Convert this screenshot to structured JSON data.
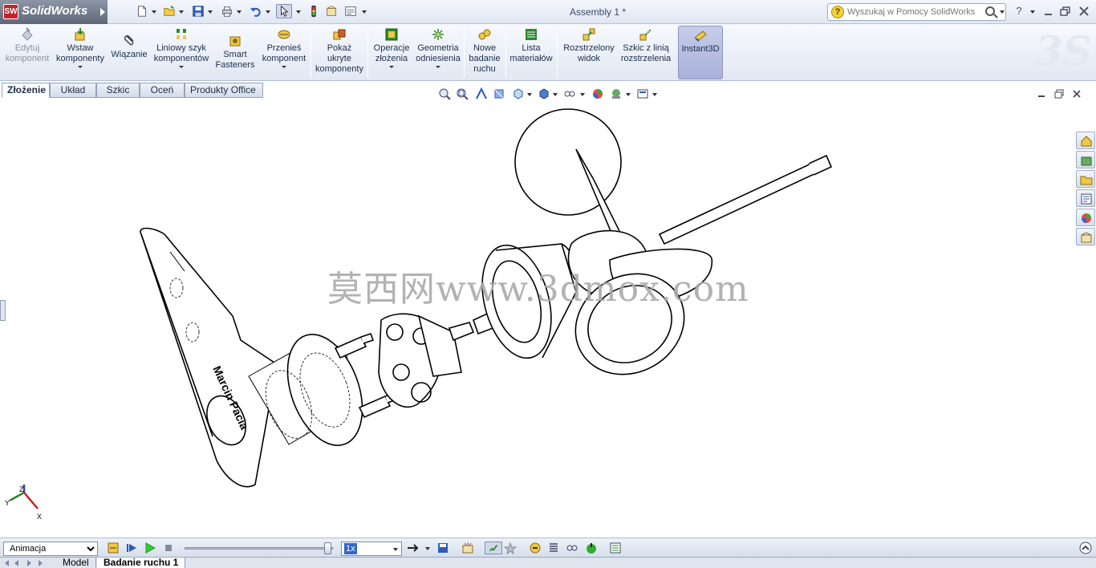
{
  "app": {
    "brand": "SolidWorks",
    "brand_mark": "SW"
  },
  "document": {
    "title": "Assembly 1 *"
  },
  "help": {
    "placeholder": "Wyszukaj w Pomocy SolidWorks",
    "help_glyph": "?"
  },
  "command_manager": {
    "commands": [
      {
        "id": "edit-component",
        "label": "Edytuj\nkomponent",
        "icon": "edit-component-icon",
        "enabled": false
      },
      {
        "id": "insert-components",
        "label": "Wstaw\nkomponenty",
        "icon": "insert-components-icon",
        "dropdown": true
      },
      {
        "id": "mate",
        "label": "Wiązanie",
        "icon": "mate-icon"
      },
      {
        "id": "linear-pattern",
        "label": "Liniowy szyk\nkomponentów",
        "icon": "linear-pattern-icon",
        "dropdown": true
      },
      {
        "id": "smart-fasteners",
        "label": "Smart\nFasteners",
        "icon": "smart-fasteners-icon"
      },
      {
        "id": "move-component",
        "label": "Przenieś\nkomponent",
        "icon": "move-component-icon",
        "dropdown": true
      },
      {
        "id": "show-hidden",
        "label": "Pokaż\nukryte\nkomponenty",
        "icon": "show-hidden-icon"
      },
      {
        "id": "assembly-features",
        "label": "Operacje\nzłożenia",
        "icon": "assembly-features-icon",
        "dropdown": true
      },
      {
        "id": "reference-geometry",
        "label": "Geometria\nodniesienia",
        "icon": "reference-geometry-icon",
        "dropdown": true
      },
      {
        "id": "new-motion-study",
        "label": "Nowe\nbadanie\nruchu",
        "icon": "motion-study-icon"
      },
      {
        "id": "bill-of-materials",
        "label": "Lista\nmateriałów",
        "icon": "bom-icon"
      },
      {
        "id": "exploded-view",
        "label": "Rozstrzelony\nwidok",
        "icon": "exploded-view-icon"
      },
      {
        "id": "explode-line-sketch",
        "label": "Szkic z linią\nrozstrzelenia",
        "icon": "explode-line-icon"
      },
      {
        "id": "instant3d",
        "label": "Instant3D",
        "icon": "instant3d-icon",
        "active": true
      }
    ]
  },
  "tabs": [
    {
      "label": "Złożenie",
      "active": true
    },
    {
      "label": "Układ"
    },
    {
      "label": "Szkic"
    },
    {
      "label": "Oceń"
    },
    {
      "label": "Produkty Office"
    }
  ],
  "viewport": {
    "overlay_text": "莫西网www.3dmox.com",
    "engraved_text": "Marcin Pacia",
    "triad": {
      "x": "X",
      "y": "Y",
      "z": "Z"
    }
  },
  "motion_manager": {
    "study_type": "Animacja",
    "study_options": [
      "Animacja"
    ],
    "playback_speed": "1x",
    "speed_options": [
      "1x"
    ]
  },
  "bottom_tabs": [
    {
      "label": "Model"
    },
    {
      "label": "Badanie ruchu 1",
      "active": true
    }
  ],
  "colors": {
    "accent": "#3366cc",
    "brand_red": "#c8202a",
    "active_cmd": "#a9b1db"
  }
}
